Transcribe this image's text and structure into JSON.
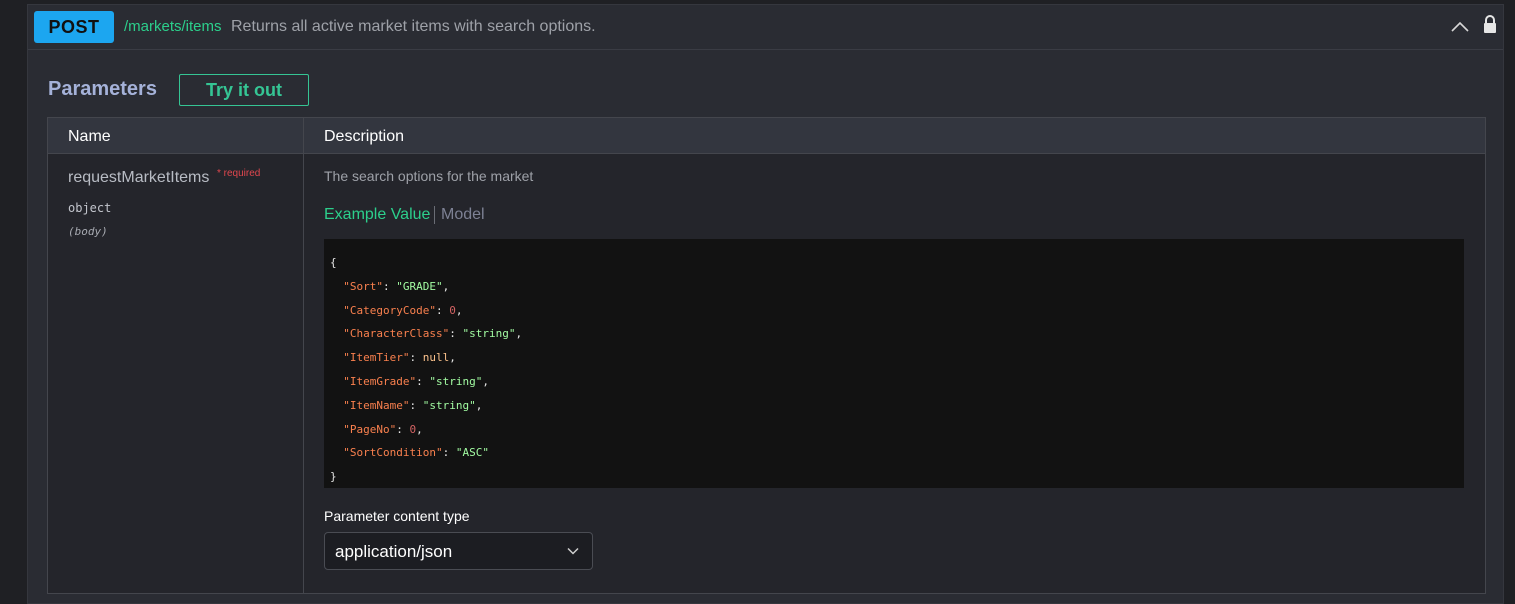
{
  "operation": {
    "method": "POST",
    "path": "/markets/items",
    "summary": "Returns all active market items with search options."
  },
  "parameters": {
    "title": "Parameters",
    "try_label": "Try it out",
    "columns": {
      "name": "Name",
      "description": "Description"
    },
    "param": {
      "name": "requestMarketItems",
      "required_label": "* required",
      "type": "object",
      "in": "(body)",
      "description": "The search options for the market"
    },
    "tabs": {
      "example": "Example Value",
      "model": "Model"
    },
    "example_lines": [
      {
        "indent": false,
        "key": "",
        "value": "",
        "vtype": "",
        "text": "{"
      },
      {
        "indent": true,
        "key": "\"Sort\"",
        "value": "\"GRADE\"",
        "vtype": "s",
        "comma": true
      },
      {
        "indent": true,
        "key": "\"CategoryCode\"",
        "value": "0",
        "vtype": "n",
        "comma": true
      },
      {
        "indent": true,
        "key": "\"CharacterClass\"",
        "value": "\"string\"",
        "vtype": "s",
        "comma": true
      },
      {
        "indent": true,
        "key": "\"ItemTier\"",
        "value": "null",
        "vtype": "l",
        "comma": true
      },
      {
        "indent": true,
        "key": "\"ItemGrade\"",
        "value": "\"string\"",
        "vtype": "s",
        "comma": true
      },
      {
        "indent": true,
        "key": "\"ItemName\"",
        "value": "\"string\"",
        "vtype": "s",
        "comma": true
      },
      {
        "indent": true,
        "key": "\"PageNo\"",
        "value": "0",
        "vtype": "n",
        "comma": true
      },
      {
        "indent": true,
        "key": "\"SortCondition\"",
        "value": "\"ASC\"",
        "vtype": "s",
        "comma": false
      },
      {
        "indent": false,
        "key": "",
        "value": "",
        "vtype": "",
        "text": "}"
      }
    ],
    "content_type_label": "Parameter content type",
    "content_type_value": "application/json"
  },
  "colors": {
    "method_badge": "#1ca6f0",
    "path": "#2ccf8c",
    "try_button": "#35c594",
    "required": "#e0474e"
  },
  "icons": {
    "collapse": "chevron-up-icon",
    "lock": "lock-icon",
    "select": "chevron-down-icon"
  }
}
